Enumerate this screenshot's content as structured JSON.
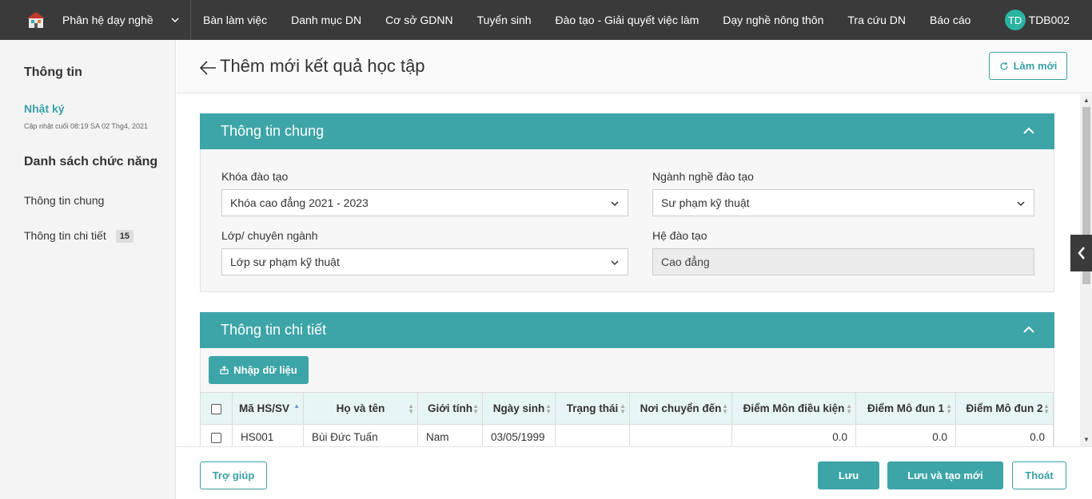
{
  "topbar": {
    "module": "Phân hệ dạy nghề",
    "nav": [
      "Bàn làm việc",
      "Danh mục DN",
      "Cơ sở GDNN",
      "Tuyển sinh",
      "Đào tạo - Giải quyết việc làm",
      "Dạy nghề nông thôn",
      "Tra cứu DN",
      "Báo cáo"
    ],
    "user_initials": "TD",
    "user_name": "TDB002"
  },
  "sidebar": {
    "info_title": "Thông tin",
    "log_label": "Nhật ký",
    "log_updated": "Cập nhật cuối 08:19 SA 02 Thg4, 2021",
    "functions_title": "Danh sách chức năng",
    "items": [
      {
        "label": "Thông tin chung"
      },
      {
        "label": "Thông tin chi tiết",
        "badge": "15"
      }
    ]
  },
  "header": {
    "title": "Thêm mới kết quả học tập",
    "refresh_label": "Làm mới"
  },
  "general": {
    "title": "Thông tin chung",
    "course_label": "Khóa đào tạo",
    "course_value": "Khóa cao đẳng 2021 - 2023",
    "major_label": "Ngành nghề đào tạo",
    "major_value": "Sư phạm kỹ thuật",
    "class_label": "Lớp/ chuyên ngành",
    "class_value": "Lớp sư phạm kỹ thuật",
    "level_label": "Hệ đào tạo",
    "level_value": "Cao đẳng"
  },
  "detail": {
    "title": "Thông tin chi tiết",
    "import_label": "Nhập dữ liệu",
    "columns": [
      "Mã HS/SV",
      "Họ và tên",
      "Giới tính",
      "Ngày sinh",
      "Trạng thái",
      "Nơi chuyển đến",
      "Điểm Môn điều kiện",
      "Điểm Mô đun 1",
      "Điểm Mô đun 2"
    ],
    "rows": [
      {
        "id": "HS001",
        "name": "Bùi Đức Tuấn",
        "gender": "Nam",
        "dob": "03/05/1999",
        "status": "",
        "transfer": "",
        "cond": "0.0",
        "mod1": "0.0",
        "mod2": "0.0"
      }
    ]
  },
  "footer": {
    "help_label": "Trợ giúp",
    "save_label": "Lưu",
    "save_new_label": "Lưu và tạo mới",
    "exit_label": "Thoát"
  },
  "colors": {
    "accent": "#3da5a8",
    "topbar": "#3a3a3a"
  }
}
